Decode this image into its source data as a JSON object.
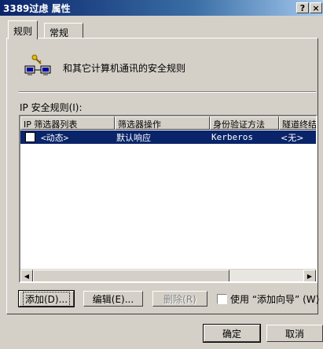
{
  "window": {
    "title": "3389过虑 属性",
    "help_label": "?",
    "close_label": "×"
  },
  "tabs": [
    {
      "label": "规则"
    },
    {
      "label": "常规"
    }
  ],
  "header": {
    "description": "和其它计算机通讯的安全规则"
  },
  "list": {
    "label": "IP 安全规则(I):",
    "columns": [
      "IP 筛选器列表",
      "筛选器操作",
      "身份验证方法",
      "隧道终结"
    ],
    "rows": [
      {
        "filter_list": "<动态>",
        "filter_action": "默认响应",
        "auth": "Kerberos",
        "tunnel": "<无>"
      }
    ]
  },
  "buttons": {
    "add": "添加(D)...",
    "edit": "编辑(E)...",
    "remove": "删除(R)",
    "ok": "确定",
    "cancel": "取消"
  },
  "wizard": {
    "label": "使用 “添加向导” (W)"
  }
}
